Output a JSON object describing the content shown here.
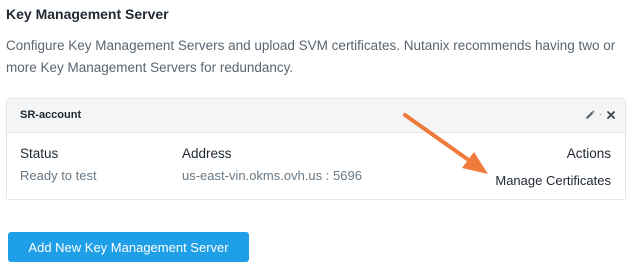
{
  "section": {
    "title": "Key Management Server",
    "description": "Configure Key Management Servers and upload SVM certificates. Nutanix recommends having two or more Key Management Servers for redundancy."
  },
  "kms_card": {
    "name": "SR-account",
    "columns": {
      "status_label": "Status",
      "address_label": "Address",
      "actions_label": "Actions"
    },
    "status": "Ready to test",
    "address": "us-east-vin.okms.ovh.us : 5696",
    "manage_label": "Manage Certificates",
    "edit_icon": "pencil-icon",
    "delete_icon": "close-icon"
  },
  "add_button_label": "Add New Key Management Server",
  "colors": {
    "accent": "#1e9fe8",
    "annotation_arrow": "#f07a3a"
  }
}
